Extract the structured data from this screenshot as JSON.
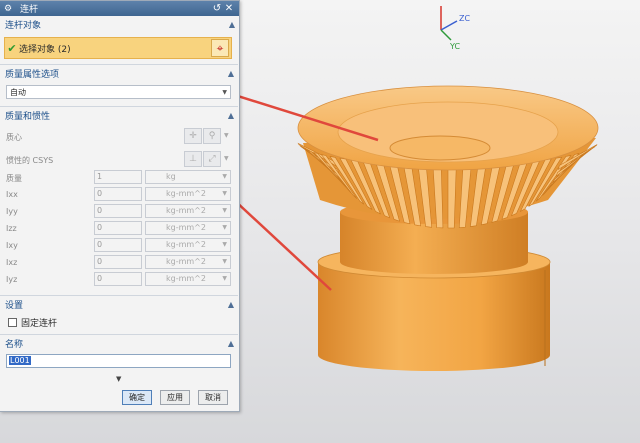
{
  "dialog": {
    "title": "连杆",
    "title_icons": {
      "gear": "gear-icon",
      "reset": "reset-icon",
      "close": "close-icon"
    }
  },
  "sections": {
    "link_object": {
      "header": "连杆对象",
      "select_label": "选择对象 (2)"
    },
    "mass_options": {
      "header": "质量属性选项",
      "selected": "自动"
    },
    "mass_inertia": {
      "header": "质量和惯性",
      "center_of_mass_label": "质心",
      "csys_label": "惯性的 CSYS",
      "mass_label": "质量",
      "mass_value": "1",
      "mass_unit": "kg",
      "inertia": [
        {
          "label": "Ixx",
          "value": "0",
          "unit": "kg-mm^2"
        },
        {
          "label": "Iyy",
          "value": "0",
          "unit": "kg-mm^2"
        },
        {
          "label": "Izz",
          "value": "0",
          "unit": "kg-mm^2"
        },
        {
          "label": "Ixy",
          "value": "0",
          "unit": "kg-mm^2"
        },
        {
          "label": "Ixz",
          "value": "0",
          "unit": "kg-mm^2"
        },
        {
          "label": "Iyz",
          "value": "0",
          "unit": "kg-mm^2"
        }
      ]
    },
    "settings": {
      "header": "设置",
      "fix_link_label": "固定连杆"
    },
    "name": {
      "header": "名称",
      "value": "L001"
    }
  },
  "buttons": {
    "ok": "确定",
    "apply": "应用",
    "cancel": "取消"
  },
  "triad": {
    "zc": "ZC",
    "yc": "YC"
  },
  "colors": {
    "gear_fill": "#f2a544",
    "gear_light": "#f7c27a",
    "gear_dark": "#c9781e",
    "select_highlight": "#f8d37e",
    "arrow": "#e0483c",
    "header_text": "#1c4f8a"
  }
}
